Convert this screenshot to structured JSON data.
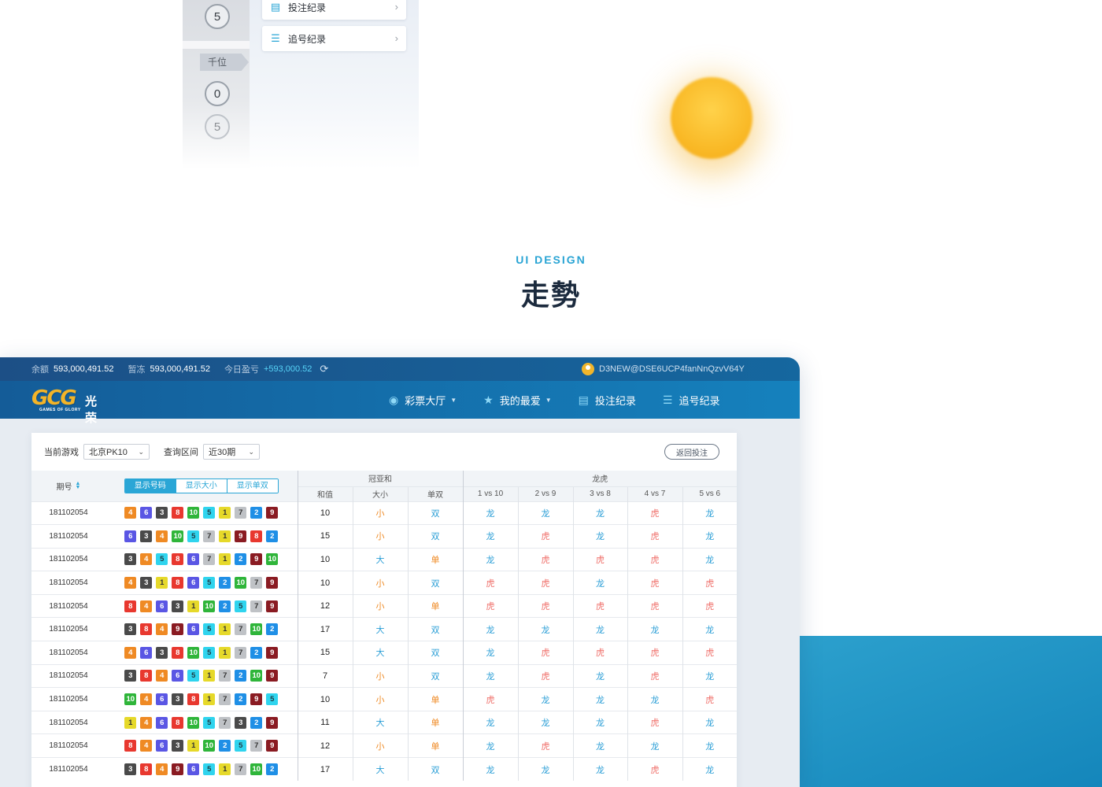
{
  "preview": {
    "balls_left": [
      "5",
      "0",
      "5"
    ],
    "position_tag": "千位",
    "cards": [
      {
        "label": "投注纪录",
        "icon": "clipboard-icon"
      },
      {
        "label": "追号纪录",
        "icon": "list-icon"
      }
    ]
  },
  "section": {
    "label": "UI DESIGN",
    "title": "走勢"
  },
  "topbar": {
    "balance_label": "余额",
    "balance_value": "593,000,491.52",
    "frozen_label": "暂冻",
    "frozen_value": "593,000,491.52",
    "profit_label": "今日盈亏",
    "profit_value": "+593,000.52",
    "username": "D3NEW@DSE6UCP4fanNnQzvV64Y"
  },
  "navbar": {
    "logo_text": "GCG",
    "logo_cn": "光荣",
    "logo_sub": "GAMES OF GLORY",
    "items": [
      {
        "label": "彩票大厅",
        "icon": "lottery-icon"
      },
      {
        "label": "我的最爱",
        "icon": "star-icon"
      },
      {
        "label": "投注纪录",
        "icon": "clipboard-icon"
      },
      {
        "label": "追号纪录",
        "icon": "list-icon"
      }
    ]
  },
  "filters": {
    "game_label": "当前游戏",
    "game_value": "北京PK10",
    "range_label": "查询区间",
    "range_value": "近30期",
    "back_label": "返回投注"
  },
  "table": {
    "issue_header": "期号",
    "view_toggle": [
      "显示号码",
      "显示大小",
      "显示单双"
    ],
    "group_sum": "冠亚和",
    "group_dragon": "龙虎",
    "sub_headers": [
      "和值",
      "大小",
      "单双",
      "1 vs 10",
      "2 vs 9",
      "3 vs 8",
      "4 vs 7",
      "5 vs 6"
    ],
    "rows": [
      {
        "issue": "181102054",
        "balls": [
          4,
          6,
          3,
          8,
          10,
          5,
          1,
          7,
          2,
          9
        ],
        "sum": "10",
        "size": "小",
        "parity": "双",
        "dt": [
          "龙",
          "龙",
          "龙",
          "虎",
          "龙"
        ]
      },
      {
        "issue": "181102054",
        "balls": [
          6,
          3,
          4,
          10,
          5,
          7,
          1,
          9,
          8,
          2
        ],
        "sum": "15",
        "size": "小",
        "parity": "双",
        "dt": [
          "龙",
          "虎",
          "龙",
          "虎",
          "龙"
        ]
      },
      {
        "issue": "181102054",
        "balls": [
          3,
          4,
          5,
          8,
          6,
          7,
          1,
          2,
          9,
          10
        ],
        "sum": "10",
        "size": "大",
        "parity": "单",
        "dt": [
          "龙",
          "虎",
          "虎",
          "虎",
          "龙"
        ]
      },
      {
        "issue": "181102054",
        "balls": [
          4,
          3,
          1,
          8,
          6,
          5,
          2,
          10,
          7,
          9
        ],
        "sum": "10",
        "size": "小",
        "parity": "双",
        "dt": [
          "虎",
          "虎",
          "龙",
          "虎",
          "虎"
        ]
      },
      {
        "issue": "181102054",
        "balls": [
          8,
          4,
          6,
          3,
          1,
          10,
          2,
          5,
          7,
          9
        ],
        "sum": "12",
        "size": "小",
        "parity": "单",
        "dt": [
          "虎",
          "虎",
          "虎",
          "虎",
          "虎"
        ]
      },
      {
        "issue": "181102054",
        "balls": [
          3,
          8,
          4,
          9,
          6,
          5,
          1,
          7,
          10,
          2
        ],
        "sum": "17",
        "size": "大",
        "parity": "双",
        "dt": [
          "龙",
          "龙",
          "龙",
          "龙",
          "龙"
        ]
      },
      {
        "issue": "181102054",
        "balls": [
          4,
          6,
          3,
          8,
          10,
          5,
          1,
          7,
          2,
          9
        ],
        "sum": "15",
        "size": "大",
        "parity": "双",
        "dt": [
          "龙",
          "虎",
          "虎",
          "虎",
          "虎"
        ]
      },
      {
        "issue": "181102054",
        "balls": [
          3,
          8,
          4,
          6,
          5,
          1,
          7,
          2,
          10,
          9
        ],
        "sum": "7",
        "size": "小",
        "parity": "双",
        "dt": [
          "龙",
          "虎",
          "龙",
          "虎",
          "龙"
        ]
      },
      {
        "issue": "181102054",
        "balls": [
          10,
          4,
          6,
          3,
          8,
          1,
          7,
          2,
          9,
          5
        ],
        "sum": "10",
        "size": "小",
        "parity": "单",
        "dt": [
          "虎",
          "龙",
          "龙",
          "龙",
          "虎"
        ]
      },
      {
        "issue": "181102054",
        "balls": [
          1,
          4,
          6,
          8,
          10,
          5,
          7,
          3,
          2,
          9
        ],
        "sum": "11",
        "size": "大",
        "parity": "单",
        "dt": [
          "龙",
          "龙",
          "龙",
          "虎",
          "龙"
        ]
      },
      {
        "issue": "181102054",
        "balls": [
          8,
          4,
          6,
          3,
          1,
          10,
          2,
          5,
          7,
          9
        ],
        "sum": "12",
        "size": "小",
        "parity": "单",
        "dt": [
          "龙",
          "虎",
          "龙",
          "龙",
          "龙"
        ]
      },
      {
        "issue": "181102054",
        "balls": [
          3,
          8,
          4,
          9,
          6,
          5,
          1,
          7,
          10,
          2
        ],
        "sum": "17",
        "size": "大",
        "parity": "双",
        "dt": [
          "龙",
          "龙",
          "龙",
          "虎",
          "龙"
        ]
      }
    ]
  }
}
